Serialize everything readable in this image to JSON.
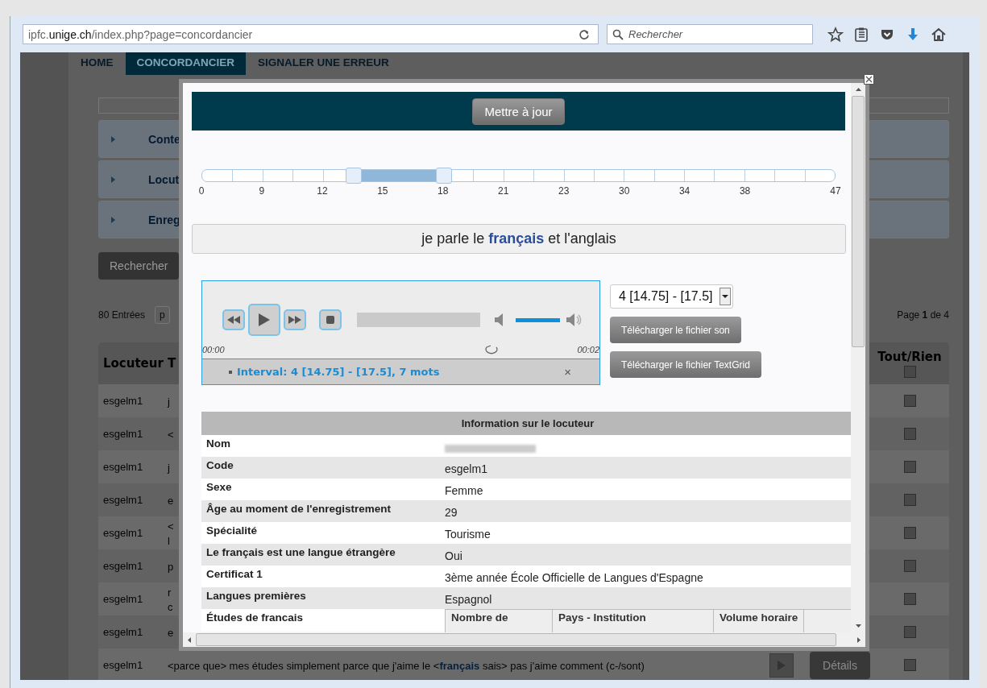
{
  "browser": {
    "url_host_prefix": "ipfc.",
    "url_host": "unige.ch",
    "url_path": "/index.php?page=concordancier",
    "search_placeholder": "Rechercher"
  },
  "nav": [
    {
      "label": "HOME",
      "selected": false
    },
    {
      "label": "CONCORDANCIER",
      "selected": true
    },
    {
      "label": "SIGNALER UNE ERREUR",
      "selected": false
    }
  ],
  "accordion": [
    {
      "label": "Conte"
    },
    {
      "label": "Locut"
    },
    {
      "label": "Enreg"
    }
  ],
  "search_button": "Rechercher",
  "entries": "80 Entrées",
  "page_select": "p",
  "pagination": "Page **1** de 4",
  "table": {
    "columns": [
      "Locuteur",
      "T",
      "Tout/Rien"
    ],
    "header_checked": false,
    "rows": [
      {
        "speaker": "esgelm1",
        "text": "j",
        "checked": false
      },
      {
        "speaker": "esgelm1",
        "text": "<",
        "checked": false
      },
      {
        "speaker": "esgelm1",
        "text": "j",
        "checked": false
      },
      {
        "speaker": "esgelm1",
        "text": "e",
        "checked": false
      },
      {
        "speaker": "esgelm1",
        "text": "<\nl",
        "checked": false
      },
      {
        "speaker": "esgelm1",
        "text": "p",
        "checked": false
      },
      {
        "speaker": "esgelm1",
        "text": "r\nc",
        "checked": false
      },
      {
        "speaker": "esgelm1",
        "text": "e",
        "checked": false
      },
      {
        "speaker": "esgelm1",
        "text": "<parce que> mes études simplement parce que j'aime le <**français** sais> pas j'aime comment (c-/sont)",
        "checked": false,
        "details": "Détails"
      }
    ]
  },
  "modal": {
    "update_button": "Mettre à jour",
    "slider": {
      "ticks": [
        "0",
        "9",
        "12",
        "15",
        "18",
        "21",
        "23",
        "30",
        "34",
        "38",
        "47"
      ],
      "handles": [
        {
          "level": 0.238
        },
        {
          "level": 0.381
        }
      ]
    },
    "sentence": "je parle le **français** et l'anglais",
    "player": {
      "time_start": "00:00",
      "time_end": "00:02",
      "progress": {
        "level": 0
      },
      "volume": {
        "level": 1
      },
      "interval": "Interval: 4 [14.75] - [17.5], 7 mots",
      "close": "×"
    },
    "interval_select": "4 [14.75] - [17.5]",
    "download_buttons": [
      "Télécharger le fichier son",
      "Télécharger le fichier TextGrid"
    ],
    "info": {
      "title": "Information sur le locuteur",
      "rows": [
        {
          "label": "Nom",
          "kind": "redacted"
        },
        {
          "label": "Code",
          "value": "esgelm1"
        },
        {
          "label": "Sexe",
          "value": "Femme"
        },
        {
          "label": "Âge au moment de l'enregistrement",
          "value": "29"
        },
        {
          "label": "Spécialité",
          "value": "Tourisme"
        },
        {
          "label": "Le français est une langue étrangère",
          "value": "Oui"
        },
        {
          "label": "Certificat 1",
          "value": "3ème année École Officielle de Langues d'Espagne"
        },
        {
          "label": "Langues premières",
          "value": "Espagnol"
        },
        {
          "label": "Études de francais",
          "kind": "table",
          "columns": [
            "Nombre de",
            "Pays - Institution",
            "Volume horaire"
          ]
        }
      ]
    }
  }
}
